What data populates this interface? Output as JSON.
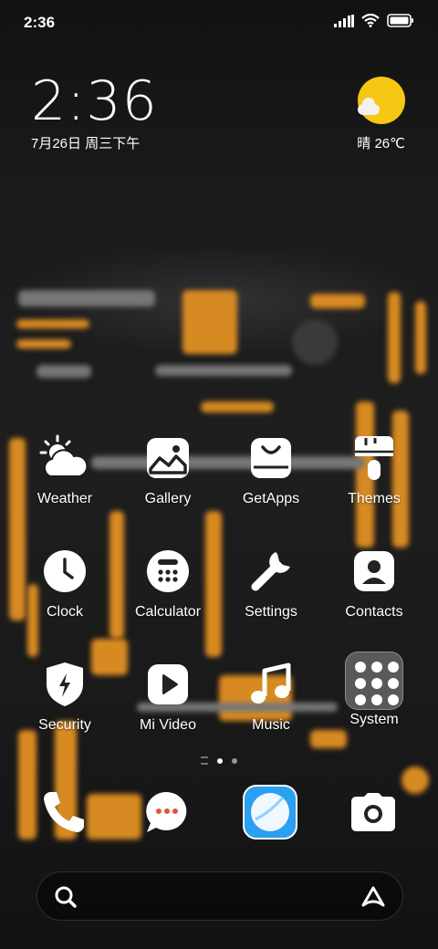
{
  "status_bar": {
    "time": "2:36",
    "icons": [
      "signal-icon",
      "wifi-icon",
      "battery-icon"
    ]
  },
  "clock_widget": {
    "time": "2:36",
    "date": "7月26日 周三下午"
  },
  "weather_widget": {
    "condition_temp": "晴 26℃",
    "icon": "sun-cloud-icon"
  },
  "apps": [
    {
      "label": "Weather",
      "icon": "weather-icon"
    },
    {
      "label": "Gallery",
      "icon": "gallery-icon"
    },
    {
      "label": "GetApps",
      "icon": "getapps-icon"
    },
    {
      "label": "Themes",
      "icon": "themes-icon"
    },
    {
      "label": "Clock",
      "icon": "clock-icon"
    },
    {
      "label": "Calculator",
      "icon": "calculator-icon"
    },
    {
      "label": "Settings",
      "icon": "settings-wrench-icon"
    },
    {
      "label": "Contacts",
      "icon": "contacts-icon"
    },
    {
      "label": "Security",
      "icon": "security-shield-icon"
    },
    {
      "label": "Mi Video",
      "icon": "mi-video-icon"
    },
    {
      "label": "Music",
      "icon": "music-icon"
    },
    {
      "label": "System",
      "icon": "system-folder-icon"
    }
  ],
  "page_indicator": {
    "pages": 2,
    "active": 1
  },
  "dock": [
    {
      "icon": "phone-icon"
    },
    {
      "icon": "messages-icon"
    },
    {
      "icon": "browser-icon"
    },
    {
      "icon": "camera-icon"
    }
  ],
  "search_bar": {
    "left_icon": "search-icon",
    "right_icon": "assistant-icon"
  }
}
